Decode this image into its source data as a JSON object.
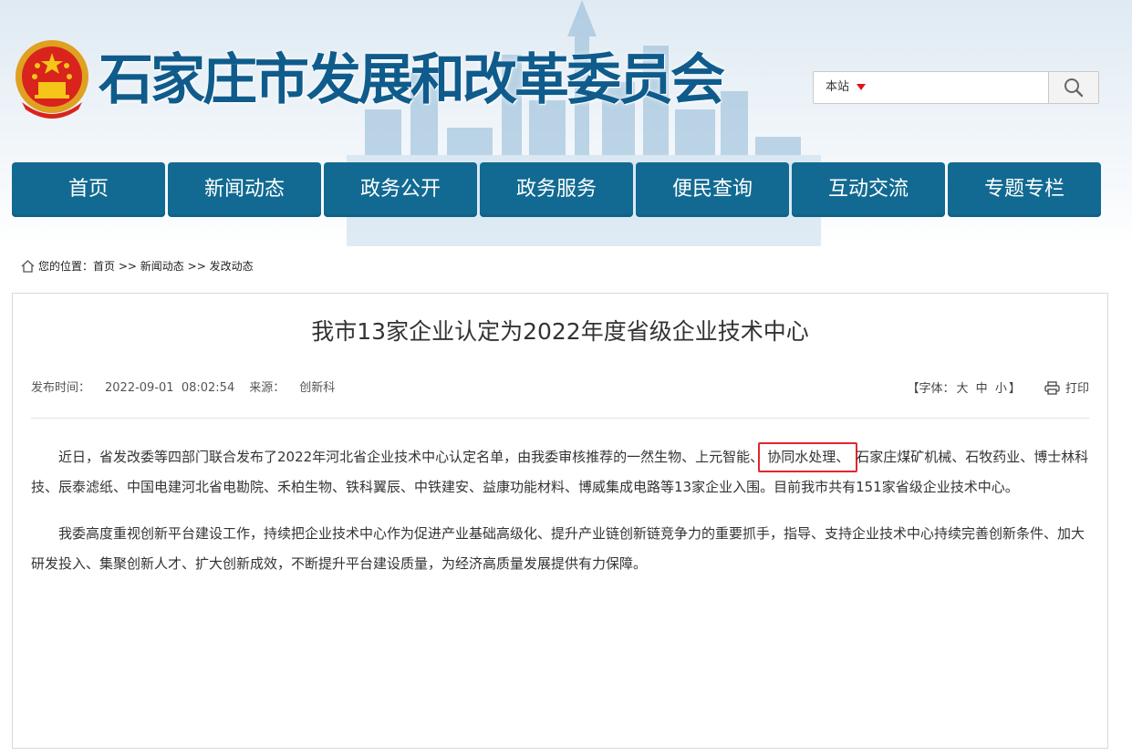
{
  "header": {
    "site_title": "石家庄市发展和改革委员会",
    "emblem_icon": "national-emblem-icon",
    "search": {
      "scope_label": "本站",
      "query": "",
      "button_icon": "search-icon"
    }
  },
  "nav": {
    "items": [
      {
        "label": "首页"
      },
      {
        "label": "新闻动态"
      },
      {
        "label": "政务公开"
      },
      {
        "label": "政务服务"
      },
      {
        "label": "便民查询"
      },
      {
        "label": "互动交流"
      },
      {
        "label": "专题专栏"
      }
    ]
  },
  "breadcrumb": {
    "prefix": "您的位置：",
    "items": [
      "首页",
      "新闻动态",
      "发改动态"
    ],
    "separator": ">>"
  },
  "article": {
    "title": "我市13家企业认定为2022年度省级企业技术中心",
    "publish_label": "发布时间：",
    "publish_time": "2022-09-01  08:02:54",
    "source_label": "来源：",
    "source": "创新科",
    "font_tool": {
      "prefix": "【字体：",
      "large": "大",
      "medium": "中",
      "small": "小",
      "suffix": "】"
    },
    "print_label": "打印",
    "paragraph1": {
      "before": "近日，省发改委等四部门联合发布了2022年河北省企业技术中心认定名单，由我委审核推荐的一然生物、上元智能、",
      "highlight": "协同水处理、",
      "after": "石家庄煤矿机械、石牧药业、博士林科技、辰泰滤纸、中国电建河北省电勘院、禾柏生物、铁科翼辰、中铁建安、益康功能材料、博威集成电路等13家企业入围。目前我市共有151家省级企业技术中心。"
    },
    "paragraph2": "我委高度重视创新平台建设工作，持续把企业技术中心作为促进产业基础高级化、提升产业链创新链竞争力的重要抓手，指导、支持企业技术中心持续完善创新条件、加大研发投入、集聚创新人才、扩大创新成效，不断提升平台建设质量，为经济高质量发展提供有力保障。"
  },
  "colors": {
    "brand_blue": "#126a92",
    "title_blue": "#0f5c8c",
    "highlight_red": "#e0282e",
    "scope_arrow_red": "#e0121c"
  }
}
